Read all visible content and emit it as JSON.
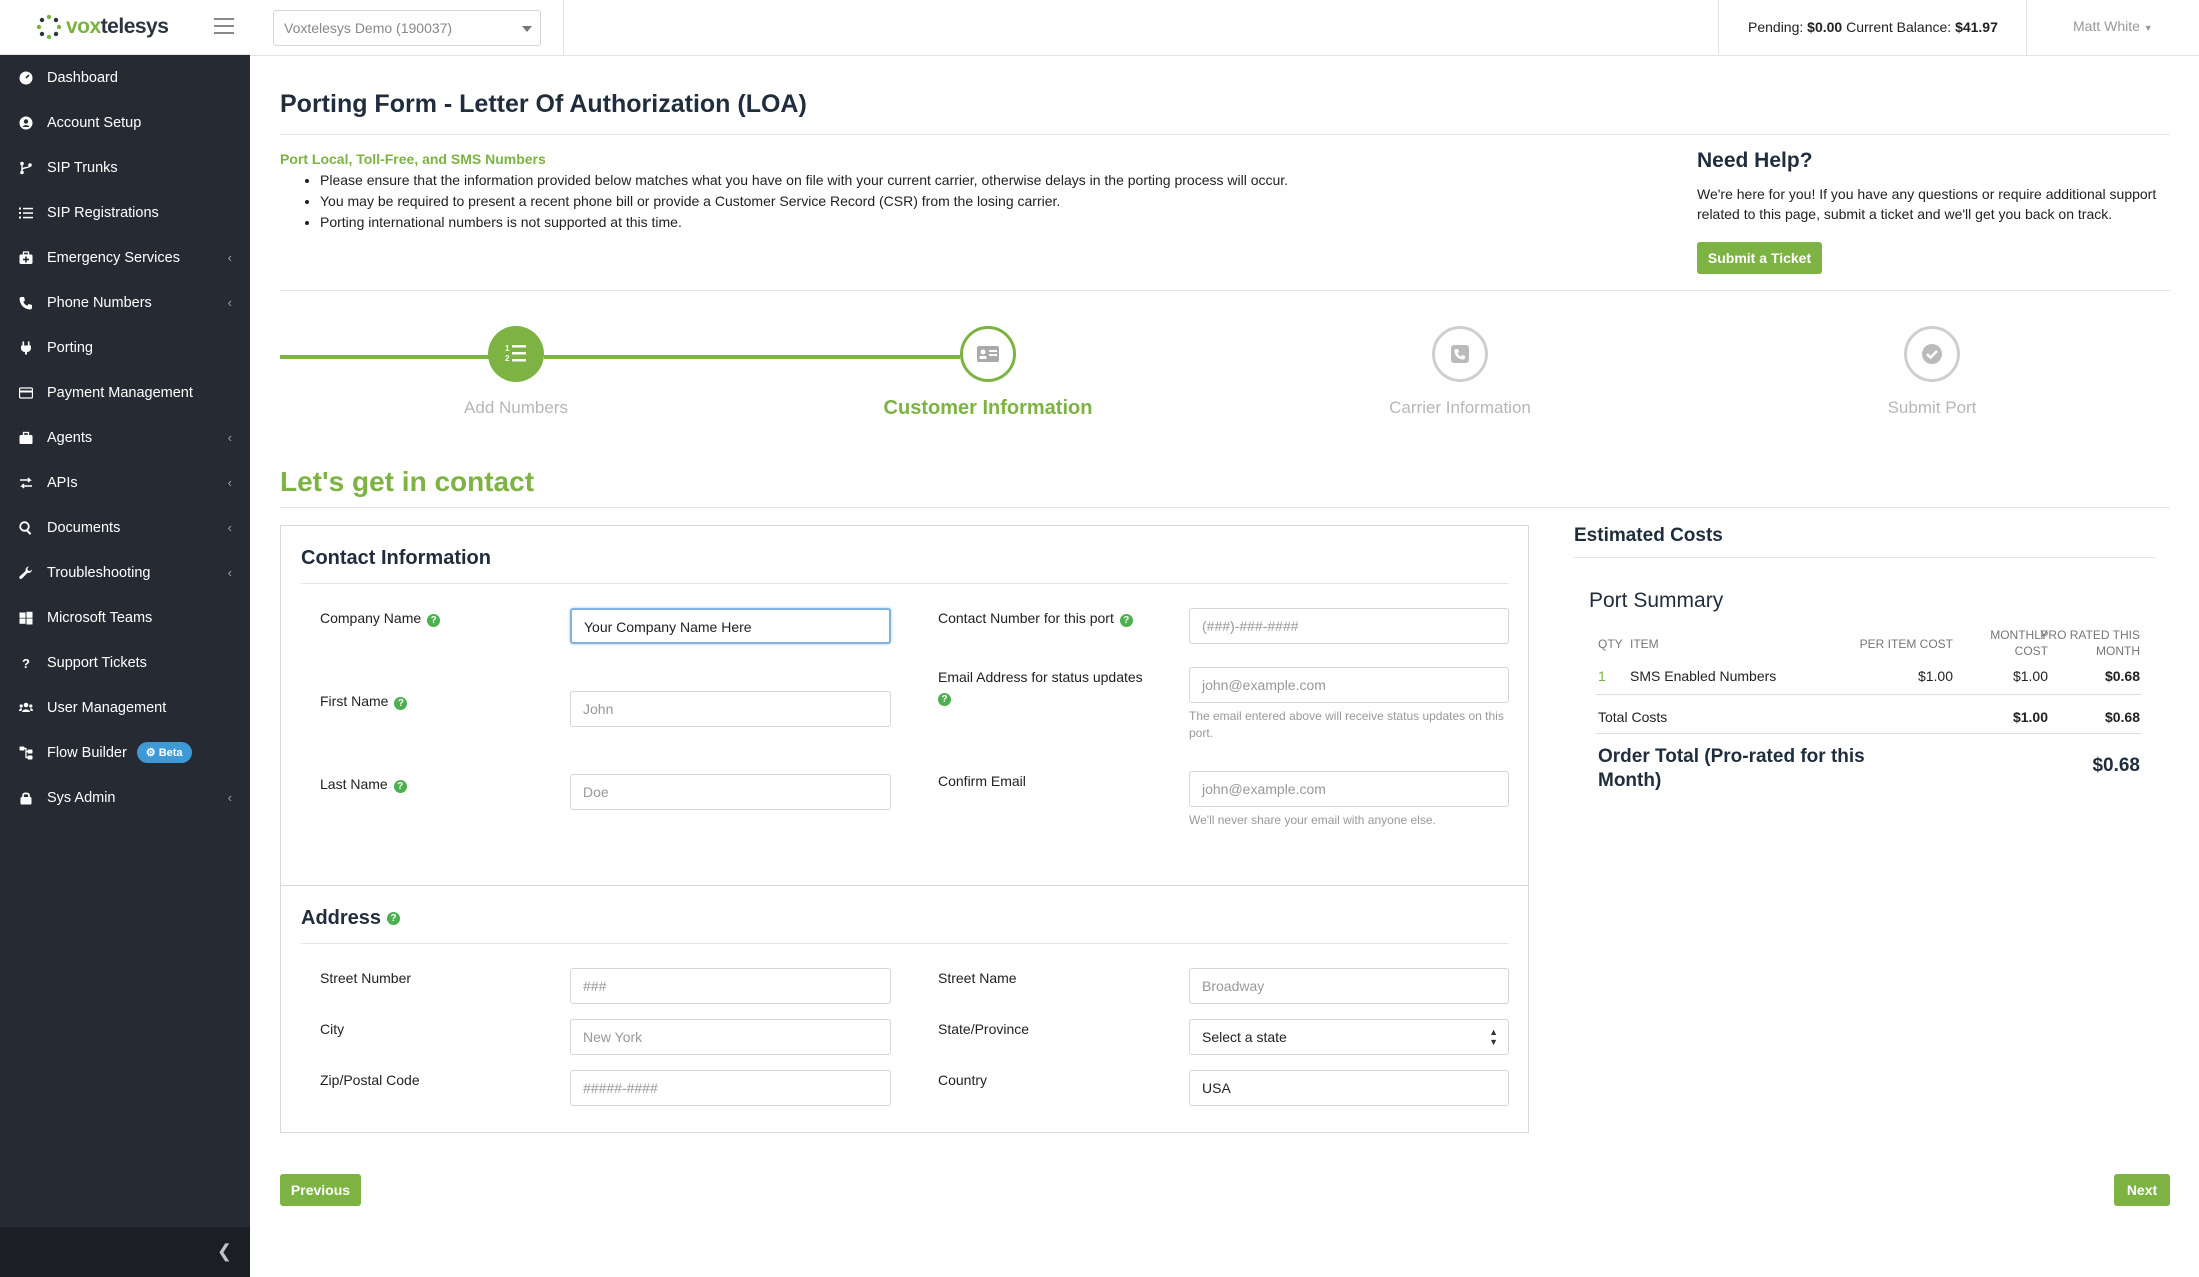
{
  "brand": {
    "name_prefix": "vox",
    "name_suffix": "telesys"
  },
  "sidebar": {
    "items": [
      {
        "label": "Dashboard",
        "icon": "dashboard-icon",
        "submenu": false
      },
      {
        "label": "Account Setup",
        "icon": "user-circle-icon",
        "submenu": false
      },
      {
        "label": "SIP Trunks",
        "icon": "branch-icon",
        "submenu": false
      },
      {
        "label": "SIP Registrations",
        "icon": "list-icon",
        "submenu": false
      },
      {
        "label": "Emergency Services",
        "icon": "medkit-icon",
        "submenu": true
      },
      {
        "label": "Phone Numbers",
        "icon": "phone-icon",
        "submenu": true
      },
      {
        "label": "Porting",
        "icon": "plug-icon",
        "submenu": false
      },
      {
        "label": "Payment Management",
        "icon": "credit-card-icon",
        "submenu": false
      },
      {
        "label": "Agents",
        "icon": "briefcase-icon",
        "submenu": true
      },
      {
        "label": "APIs",
        "icon": "exchange-icon",
        "submenu": true
      },
      {
        "label": "Documents",
        "icon": "search-icon",
        "submenu": true
      },
      {
        "label": "Troubleshooting",
        "icon": "wrench-icon",
        "submenu": true
      },
      {
        "label": "Microsoft Teams",
        "icon": "windows-icon",
        "submenu": false
      },
      {
        "label": "Support Tickets",
        "icon": "question-icon",
        "submenu": false
      },
      {
        "label": "User Management",
        "icon": "users-icon",
        "submenu": false
      },
      {
        "label": "Flow Builder",
        "icon": "sitemap-icon",
        "submenu": false,
        "badge": "Beta"
      },
      {
        "label": "Sys Admin",
        "icon": "lock-icon",
        "submenu": true
      }
    ]
  },
  "topbar": {
    "account": "Voxtelesys Demo (190037)",
    "pending_label": "Pending:",
    "pending_value": "$0.00",
    "balance_label": "Current Balance:",
    "balance_value": "$41.97",
    "user": "Matt White"
  },
  "page": {
    "title": "Porting Form - Letter Of Authorization (LOA)",
    "info_heading": "Port Local, Toll-Free, and SMS Numbers",
    "info_items": [
      "Please ensure that the information provided below matches what you have on file with your current carrier, otherwise delays in the porting process will occur.",
      "You may be required to present a recent phone bill or provide a Customer Service Record (CSR) from the losing carrier.",
      "Porting international numbers is not supported at this time."
    ],
    "help_title": "Need Help?",
    "help_text": "We're here for you! If you have any questions or require additional support related to this page, submit a ticket and we'll get you back on track.",
    "help_button": "Submit a Ticket"
  },
  "stepper": {
    "steps": [
      {
        "label": "Add Numbers",
        "state": "complete"
      },
      {
        "label": "Customer Information",
        "state": "active"
      },
      {
        "label": "Carrier Information",
        "state": "pending"
      },
      {
        "label": "Submit Port",
        "state": "pending"
      }
    ]
  },
  "form": {
    "section_heading": "Let's get in contact",
    "contact": {
      "title": "Contact Information",
      "company_label": "Company Name",
      "company_value": "Your Company Name Here",
      "first_label": "First Name",
      "first_placeholder": "John",
      "last_label": "Last Name",
      "last_placeholder": "Doe",
      "phone_label": "Contact Number for this port",
      "phone_placeholder": "(###)-###-####",
      "email_label": "Email Address for status updates",
      "email_placeholder": "john@example.com",
      "email_help": "The email entered above will receive status updates on this port.",
      "confirm_label": "Confirm Email",
      "confirm_placeholder": "john@example.com",
      "confirm_help": "We'll never share your email with anyone else."
    },
    "address": {
      "title": "Address",
      "street_number_label": "Street Number",
      "street_number_placeholder": "###",
      "street_name_label": "Street Name",
      "street_name_placeholder": "Broadway",
      "city_label": "City",
      "city_placeholder": "New York",
      "state_label": "State/Province",
      "state_value": "Select a state",
      "zip_label": "Zip/Postal Code",
      "zip_placeholder": "#####-####",
      "country_label": "Country",
      "country_value": "USA"
    },
    "previous_button": "Previous",
    "next_button": "Next"
  },
  "costs": {
    "title": "Estimated Costs",
    "summary_title": "Port Summary",
    "headers": {
      "qty": "QTY",
      "item": "ITEM",
      "per_item": "PER ITEM COST",
      "monthly_1": "MONTHLY",
      "monthly_2": "COST",
      "prorated_1": "PRO RATED THIS",
      "prorated_2": "MONTH"
    },
    "row": {
      "qty": "1",
      "item": "SMS Enabled Numbers",
      "per_item": "$1.00",
      "monthly": "$1.00",
      "prorated": "$0.68"
    },
    "total": {
      "label": "Total Costs",
      "monthly": "$1.00",
      "prorated": "$0.68"
    },
    "order_total": {
      "label_1": "Order Total (Pro-rated for this",
      "label_2": "Month)",
      "value": "$0.68"
    }
  },
  "colors": {
    "accent": "#7cb342",
    "sidebar": "#262b33",
    "inactive_step": "#c8c8c8"
  }
}
